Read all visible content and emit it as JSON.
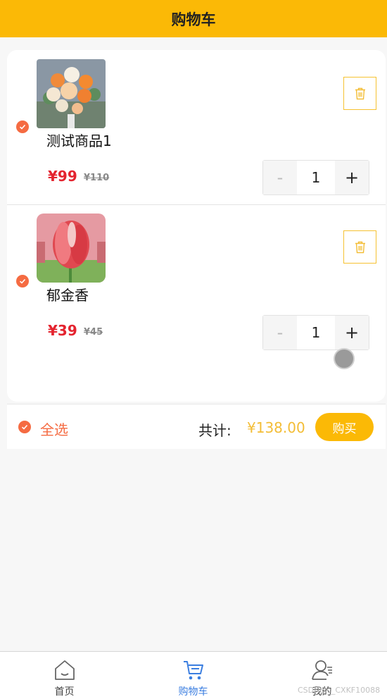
{
  "header": {
    "title": "购物车"
  },
  "items": [
    {
      "name": "测试商品1",
      "price": "¥99",
      "original_price": "¥110",
      "quantity": "1",
      "minus": "-",
      "plus": "+"
    },
    {
      "name": "郁金香",
      "price": "¥39",
      "original_price": "¥45",
      "quantity": "1",
      "minus": "-",
      "plus": "+"
    }
  ],
  "footer": {
    "select_all": "全选",
    "total_label": "共计:",
    "total_value": "¥138.00",
    "buy": "购买"
  },
  "tabs": [
    {
      "label": "首页",
      "icon": "home-icon"
    },
    {
      "label": "购物车",
      "icon": "cart-icon"
    },
    {
      "label": "我的",
      "icon": "user-icon"
    }
  ],
  "watermark": "CSDN@__CXKF10088",
  "colors": {
    "brand": "#fbb906",
    "price": "#e4242f",
    "check": "#f56b42",
    "tab_active": "#3b7ee0"
  }
}
